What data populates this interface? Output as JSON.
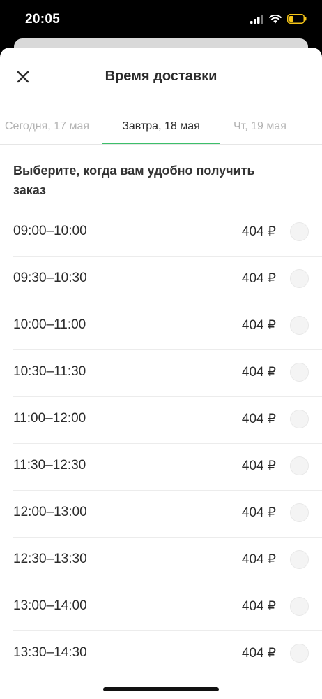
{
  "status": {
    "time": "20:05"
  },
  "header": {
    "title": "Время доставки"
  },
  "tabs": {
    "prev": "Сегодня, 17 мая",
    "active": "Завтра, 18 мая",
    "next": "Чт, 19 мая"
  },
  "prompt": "Выберите, когда вам удобно получить заказ",
  "slots": [
    {
      "time": "09:00–10:00",
      "price": "404 ₽"
    },
    {
      "time": "09:30–10:30",
      "price": "404 ₽"
    },
    {
      "time": "10:00–11:00",
      "price": "404 ₽"
    },
    {
      "time": "10:30–11:30",
      "price": "404 ₽"
    },
    {
      "time": "11:00–12:00",
      "price": "404 ₽"
    },
    {
      "time": "11:30–12:30",
      "price": "404 ₽"
    },
    {
      "time": "12:00–13:00",
      "price": "404 ₽"
    },
    {
      "time": "12:30–13:30",
      "price": "404 ₽"
    },
    {
      "time": "13:00–14:00",
      "price": "404 ₽"
    },
    {
      "time": "13:30–14:30",
      "price": "404 ₽"
    }
  ],
  "colors": {
    "accent": "#3cbf6a",
    "battery": "#f5c518"
  },
  "icons": {
    "close": "close-icon",
    "signal": "cellular-signal-icon",
    "wifi": "wifi-icon",
    "battery": "battery-icon"
  }
}
